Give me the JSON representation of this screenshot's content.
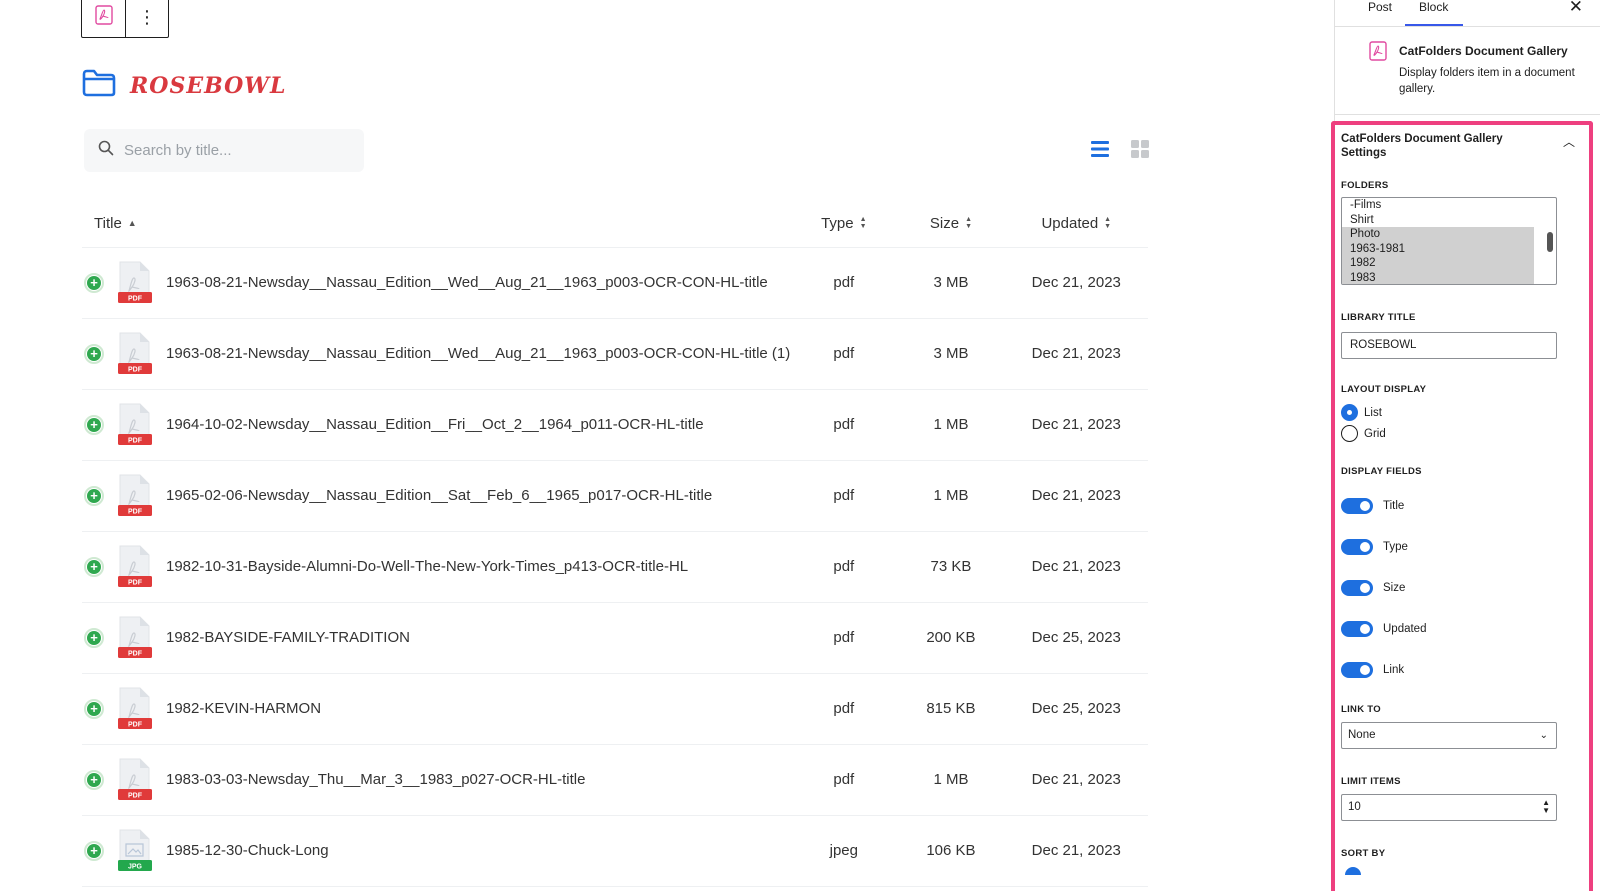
{
  "toolbar": {
    "more_label": "⋮"
  },
  "library": {
    "title": "ROSEBOWL"
  },
  "search": {
    "placeholder": "Search by title..."
  },
  "table": {
    "headers": {
      "title": "Title",
      "type": "Type",
      "size": "Size",
      "updated": "Updated"
    },
    "rows": [
      {
        "name": "1963-08-21-Newsday__Nassau_Edition__Wed__Aug_21__1963_p003-OCR-CON-HL-title",
        "type": "pdf",
        "size": "3 MB",
        "updated": "Dec 21, 2023",
        "badge": "PDF"
      },
      {
        "name": "1963-08-21-Newsday__Nassau_Edition__Wed__Aug_21__1963_p003-OCR-CON-HL-title (1)",
        "type": "pdf",
        "size": "3 MB",
        "updated": "Dec 21, 2023",
        "badge": "PDF"
      },
      {
        "name": "1964-10-02-Newsday__Nassau_Edition__Fri__Oct_2__1964_p011-OCR-HL-title",
        "type": "pdf",
        "size": "1 MB",
        "updated": "Dec 21, 2023",
        "badge": "PDF"
      },
      {
        "name": "1965-02-06-Newsday__Nassau_Edition__Sat__Feb_6__1965_p017-OCR-HL-title",
        "type": "pdf",
        "size": "1 MB",
        "updated": "Dec 21, 2023",
        "badge": "PDF"
      },
      {
        "name": "1982-10-31-Bayside-Alumni-Do-Well-The-New-York-Times_p413-OCR-title-HL",
        "type": "pdf",
        "size": "73 KB",
        "updated": "Dec 21, 2023",
        "badge": "PDF"
      },
      {
        "name": "1982-BAYSIDE-FAMILY-TRADITION",
        "type": "pdf",
        "size": "200 KB",
        "updated": "Dec 25, 2023",
        "badge": "PDF"
      },
      {
        "name": "1982-KEVIN-HARMON",
        "type": "pdf",
        "size": "815 KB",
        "updated": "Dec 25, 2023",
        "badge": "PDF"
      },
      {
        "name": "1983-03-03-Newsday_Thu__Mar_3__1983_p027-OCR-HL-title",
        "type": "pdf",
        "size": "1 MB",
        "updated": "Dec 21, 2023",
        "badge": "PDF"
      },
      {
        "name": "1985-12-30-Chuck-Long",
        "type": "jpeg",
        "size": "106 KB",
        "updated": "Dec 21, 2023",
        "badge": "JPG"
      }
    ]
  },
  "sidebar": {
    "tabs": {
      "post": "Post",
      "block": "Block"
    },
    "close": "✕",
    "block_card": {
      "name": "CatFolders Document Gallery",
      "description": "Display folders item in a document gallery."
    },
    "settings": {
      "heading": "CatFolders Document Gallery Settings",
      "folders_label": "FOLDERS",
      "folders": [
        {
          "label": "-Films",
          "selected": false
        },
        {
          "label": "Shirt",
          "selected": false
        },
        {
          "label": "Photo",
          "selected": true
        },
        {
          "label": "1963-1981",
          "selected": true
        },
        {
          "label": "1982",
          "selected": true
        },
        {
          "label": "1983",
          "selected": true
        }
      ],
      "library_title_label": "LIBRARY TITLE",
      "library_title_value": "ROSEBOWL",
      "layout_label": "LAYOUT DISPLAY",
      "layout_list": "List",
      "layout_grid": "Grid",
      "display_fields_label": "DISPLAY FIELDS",
      "fields": {
        "title": "Title",
        "type": "Type",
        "size": "Size",
        "updated": "Updated",
        "link": "Link"
      },
      "link_to_label": "LINK TO",
      "link_to_value": "None",
      "limit_label": "LIMIT ITEMS",
      "limit_value": "10",
      "sort_label": "SORT BY"
    }
  },
  "colors": {
    "accent": "#1e6fdf",
    "title_red": "#d9393f",
    "highlight_border": "#ee3f7f",
    "pdf_badge": "#e03a3a",
    "jpg_badge": "#23a84d",
    "add_green": "#2fa84f"
  }
}
